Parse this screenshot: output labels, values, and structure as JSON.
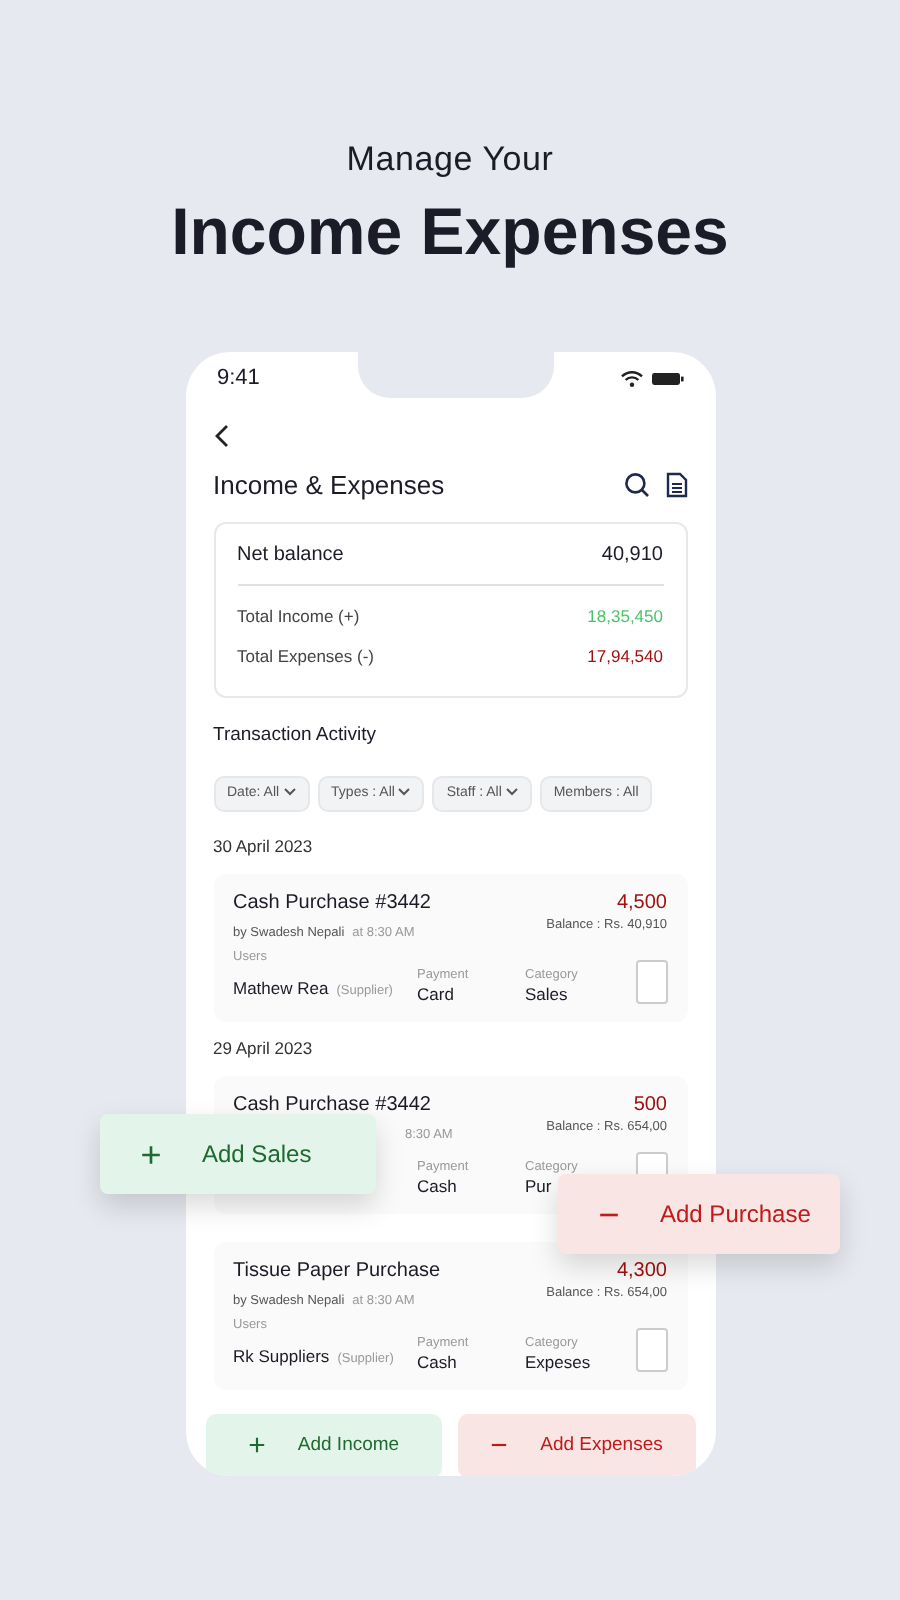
{
  "headline": {
    "subtitle": "Manage Your",
    "title": "Income Expenses"
  },
  "status_bar": {
    "time": "9:41"
  },
  "screen_title": "Income & Expenses",
  "summary": {
    "net_label": "Net balance",
    "net_value": "40,910",
    "rows": [
      {
        "label": "Total Income (+)",
        "value": "18,35,450",
        "kind": "income"
      },
      {
        "label": "Total Expenses (-)",
        "value": "17,94,540",
        "kind": "expense"
      }
    ]
  },
  "section_title": "Transaction Activity",
  "filters": [
    "Date: All",
    "Types : All",
    "Staff : All",
    "Members : All"
  ],
  "groups": [
    {
      "date": "30 April 2023",
      "transactions": [
        {
          "title": "Cash Purchase #3442",
          "amount": "4,500",
          "by": "by Swadesh Nepali",
          "time": "at 8:30 AM",
          "balance": "Balance : Rs. 40,910",
          "users_label": "Users",
          "user": "Mathew Rea",
          "user_tag": "(Supplier)",
          "payment_label": "Payment",
          "payment": "Card",
          "category_label": "Category",
          "category": "Sales"
        }
      ]
    },
    {
      "date": "29 April 2023",
      "transactions": [
        {
          "title": "Cash Purchase #3442",
          "amount": "500",
          "time": "8:30 AM",
          "balance": "Balance : Rs. 654,00",
          "payment_label": "Payment",
          "payment": "Cash",
          "category_label": "Category",
          "category": "Pur"
        },
        {
          "title": "Tissue Paper Purchase",
          "amount": "4,300",
          "by": "by Swadesh Nepali",
          "time": "at 8:30 AM",
          "balance": "Balance : Rs. 654,00",
          "users_label": "Users",
          "user": "Rk Suppliers",
          "user_tag": "(Supplier)",
          "payment_label": "Payment",
          "payment": "Cash",
          "category_label": "Category",
          "category": "Expeses"
        }
      ]
    }
  ],
  "bottom_buttons": [
    {
      "label": "Add Income",
      "kind": "income"
    },
    {
      "label": "Add Expenses",
      "kind": "expense"
    }
  ],
  "floating_buttons": [
    {
      "label": "Add Sales",
      "kind": "income"
    },
    {
      "label": "Add Purchase",
      "kind": "expense"
    }
  ]
}
